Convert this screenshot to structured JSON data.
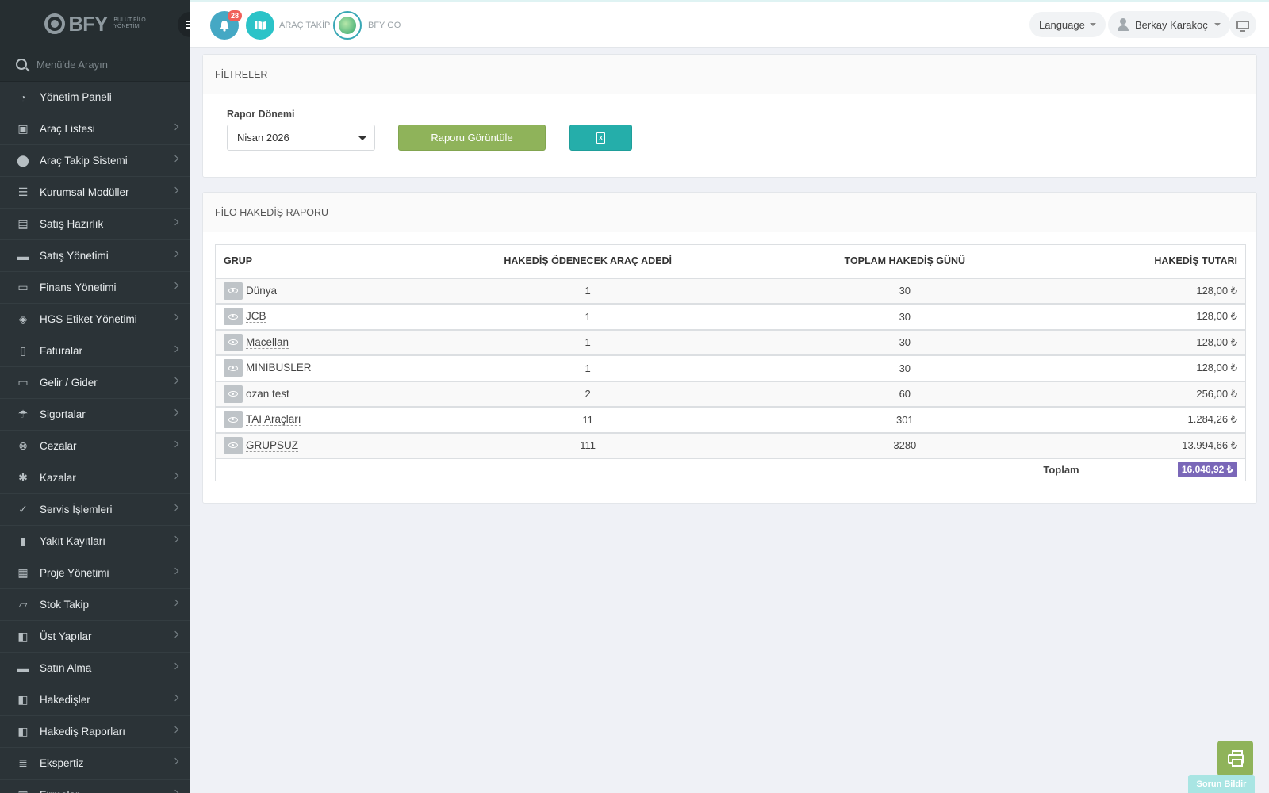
{
  "app": {
    "logo_text": "BFY",
    "logo_sub_1": "BULUT FİLO",
    "logo_sub_2": "YÖNETİMİ"
  },
  "sidebar": {
    "search_placeholder": "Menü'de Arayın",
    "items": [
      {
        "label": "Yönetim Paneli",
        "icon": "dashboard-icon"
      },
      {
        "label": "Araç Listesi",
        "icon": "bus-icon"
      },
      {
        "label": "Araç Takip Sistemi",
        "icon": "map-pin-icon"
      },
      {
        "label": "Kurumsal Modüller",
        "icon": "server-icon"
      },
      {
        "label": "Satış Hazırlık",
        "icon": "book-icon"
      },
      {
        "label": "Satış Yönetimi",
        "icon": "credit-card-icon"
      },
      {
        "label": "Finans Yönetimi",
        "icon": "money-icon"
      },
      {
        "label": "HGS Etiket Yönetimi",
        "icon": "tag-icon"
      },
      {
        "label": "Faturalar",
        "icon": "file-icon"
      },
      {
        "label": "Gelir / Gider",
        "icon": "money-icon"
      },
      {
        "label": "Sigortalar",
        "icon": "umbrella-icon"
      },
      {
        "label": "Cezalar",
        "icon": "circle-x-icon"
      },
      {
        "label": "Kazalar",
        "icon": "car-crash-icon"
      },
      {
        "label": "Servis İşlemleri",
        "icon": "check-circle-icon"
      },
      {
        "label": "Yakıt Kayıtları",
        "icon": "fuel-icon"
      },
      {
        "label": "Proje Yönetimi",
        "icon": "briefcase-icon"
      },
      {
        "label": "Stok Takip",
        "icon": "inbox-icon"
      },
      {
        "label": "Üst Yapılar",
        "icon": "truck-icon"
      },
      {
        "label": "Satın Alma",
        "icon": "credit-card-icon"
      },
      {
        "label": "Hakedişler",
        "icon": "truck-icon"
      },
      {
        "label": "Hakediş Raporları",
        "icon": "truck-icon"
      },
      {
        "label": "Ekspertiz",
        "icon": "list-icon"
      },
      {
        "label": "Firmalar",
        "icon": "building-icon"
      }
    ]
  },
  "topbar": {
    "notification_count": "28",
    "arac_takip_label": "ARAÇ TAKİP",
    "bfy_go_label": "BFY GO",
    "language_label": "Language",
    "user_name": "Berkay Karakoç"
  },
  "filters": {
    "title": "FİLTRELER",
    "period_label": "Rapor Dönemi",
    "period_value": "Nisan 2026",
    "view_button": "Raporu Görüntüle"
  },
  "report": {
    "title": "FİLO HAKEDİŞ RAPORU",
    "columns": [
      "GRUP",
      "HAKEDİŞ ÖDENECEK ARAÇ ADEDİ",
      "TOPLAM HAKEDİŞ GÜNÜ",
      "HAKEDİŞ TUTARI"
    ],
    "rows": [
      {
        "group": "Dünya",
        "count": "1",
        "days": "30",
        "amount": "128,00 ₺"
      },
      {
        "group": "JCB",
        "count": "1",
        "days": "30",
        "amount": "128,00 ₺"
      },
      {
        "group": "Macellan",
        "count": "1",
        "days": "30",
        "amount": "128,00 ₺"
      },
      {
        "group": "MİNİBUSLER",
        "count": "1",
        "days": "30",
        "amount": "128,00 ₺"
      },
      {
        "group": "ozan test",
        "count": "2",
        "days": "60",
        "amount": "256,00 ₺"
      },
      {
        "group": "TAI Araçları",
        "count": "11",
        "days": "301",
        "amount": "1.284,26 ₺"
      },
      {
        "group": "GRUPSUZ",
        "count": "111",
        "days": "3280",
        "amount": "13.994,66 ₺"
      }
    ],
    "total_label": "Toplam",
    "total_value": "16.046,92 ₺"
  },
  "footer": {
    "report_issue": "Sorun Bildir"
  }
}
